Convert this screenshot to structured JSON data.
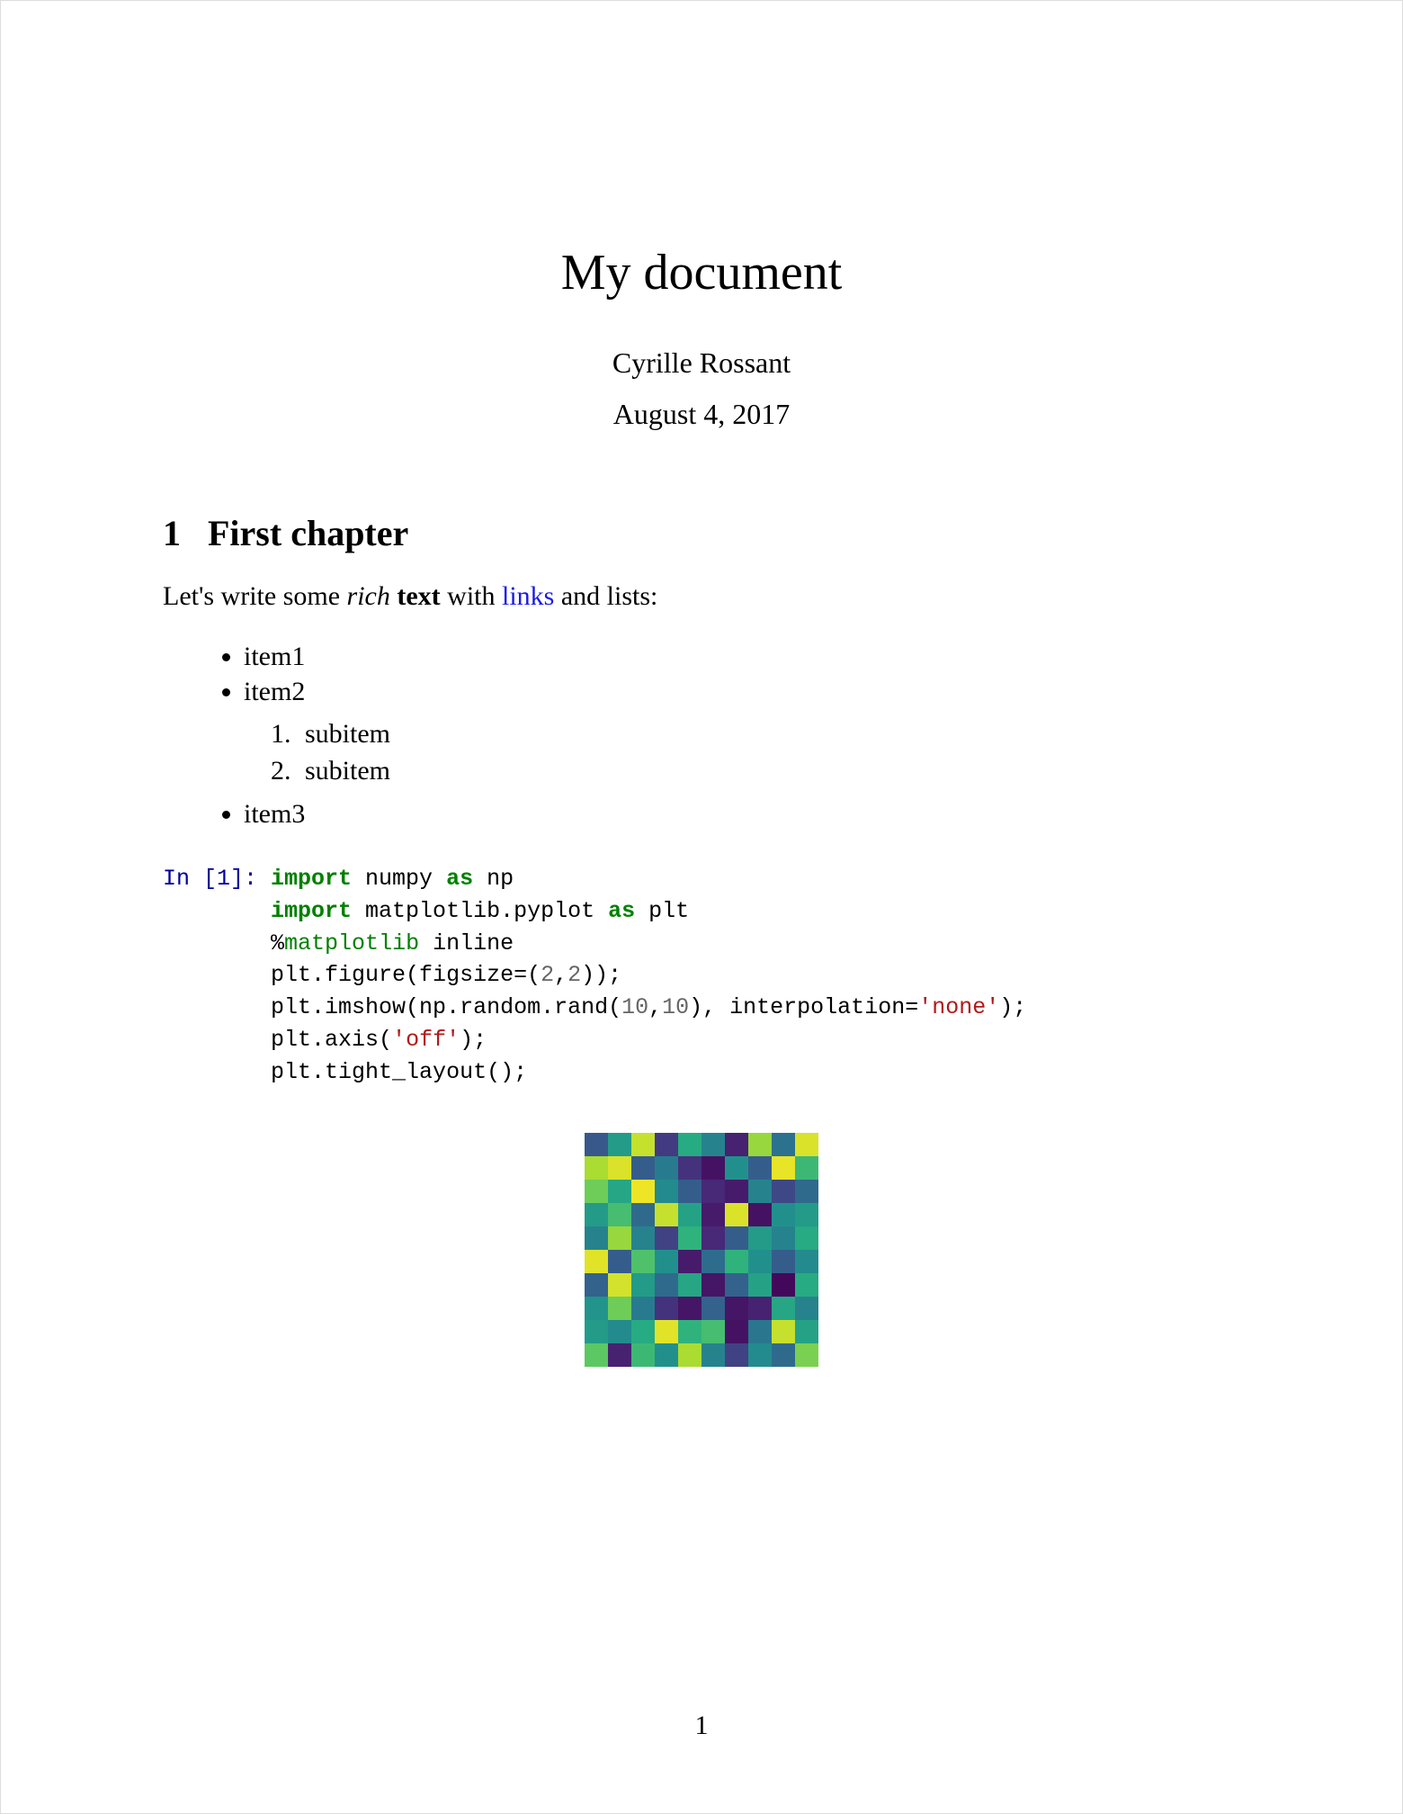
{
  "title": "My document",
  "author": "Cyrille Rossant",
  "date": "August 4, 2017",
  "section": {
    "number": "1",
    "heading": "First chapter"
  },
  "intro": {
    "prefix": "Let's write some ",
    "italic": "rich",
    "space1": " ",
    "bold": "text",
    "mid": " with ",
    "link": "links",
    "suffix": " and lists:"
  },
  "list": {
    "item1": "item1",
    "item2": "item2",
    "sub1": "subitem",
    "sub2": "subitem",
    "item3": "item3"
  },
  "code": {
    "prompt": "In [1]: ",
    "line1_import": "import",
    "line1_mod": " numpy ",
    "line1_as": "as",
    "line1_alias": " np",
    "indent": "        ",
    "line2_import": "import",
    "line2_mod": " matplotlib.pyplot ",
    "line2_as": "as",
    "line2_alias": " plt",
    "line3_pct": "%",
    "line3_magic": "matplotlib",
    "line3_rest": " inline",
    "line4_a": "plt.figure(figsize=(",
    "line4_n1": "2",
    "line4_c": ",",
    "line4_n2": "2",
    "line4_b": "));",
    "line5_a": "plt.imshow(np.random.rand(",
    "line5_n1": "10",
    "line5_c1": ",",
    "line5_n2": "10",
    "line5_b": "), interpolation=",
    "line5_str": "'none'",
    "line5_c2": ");",
    "line6_a": "plt.axis(",
    "line6_str": "'off'",
    "line6_b": ");",
    "line7": "plt.tight_layout();"
  },
  "chart_data": {
    "type": "heatmap",
    "description": "10x10 random matrix rendered with viridis colormap",
    "rows": 10,
    "cols": 10,
    "colormap": "viridis",
    "title": "",
    "xlabel": "",
    "ylabel": "",
    "values": [
      [
        0.28,
        0.55,
        0.92,
        0.18,
        0.62,
        0.45,
        0.1,
        0.85,
        0.38,
        0.95
      ],
      [
        0.88,
        0.95,
        0.3,
        0.42,
        0.15,
        0.05,
        0.5,
        0.3,
        0.97,
        0.68
      ],
      [
        0.78,
        0.6,
        0.98,
        0.48,
        0.3,
        0.12,
        0.08,
        0.45,
        0.22,
        0.35
      ],
      [
        0.55,
        0.7,
        0.35,
        0.92,
        0.58,
        0.08,
        0.95,
        0.05,
        0.5,
        0.55
      ],
      [
        0.45,
        0.85,
        0.45,
        0.2,
        0.65,
        0.12,
        0.3,
        0.55,
        0.45,
        0.62
      ],
      [
        0.96,
        0.3,
        0.72,
        0.5,
        0.08,
        0.36,
        0.65,
        0.5,
        0.3,
        0.48
      ],
      [
        0.32,
        0.94,
        0.55,
        0.35,
        0.6,
        0.06,
        0.32,
        0.58,
        0.02,
        0.62
      ],
      [
        0.52,
        0.78,
        0.42,
        0.15,
        0.06,
        0.32,
        0.06,
        0.1,
        0.6,
        0.45
      ],
      [
        0.55,
        0.48,
        0.62,
        0.96,
        0.65,
        0.7,
        0.05,
        0.4,
        0.92,
        0.58
      ],
      [
        0.75,
        0.1,
        0.68,
        0.5,
        0.88,
        0.45,
        0.2,
        0.48,
        0.35,
        0.8
      ]
    ]
  },
  "page_number": "1"
}
